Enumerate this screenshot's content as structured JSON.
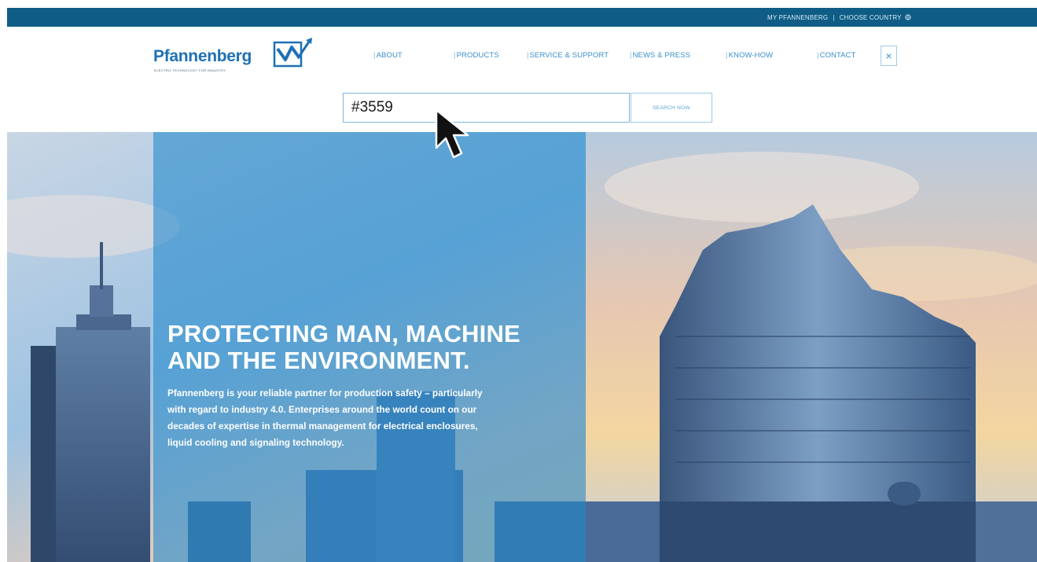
{
  "topbar": {
    "my_account": "MY PFANNENBERG",
    "separator": "|",
    "country": "CHOOSE COUNTRY",
    "country_icon": "globe-icon"
  },
  "logo": {
    "wordmark": "Pfannenberg",
    "tagline": "ELECTRO-TECHNOLOGY FOR INDUSTRY"
  },
  "nav": {
    "items": [
      {
        "label": "ABOUT"
      },
      {
        "label": "PRODUCTS"
      },
      {
        "label": "SERVICE & SUPPORT"
      },
      {
        "label": "NEWS & PRESS"
      },
      {
        "label": "KNOW-HOW"
      },
      {
        "label": "CONTACT"
      }
    ],
    "close_icon": "close-icon",
    "close_glyph": "×"
  },
  "search": {
    "value": "#3559",
    "button_label": "SEARCH NOW"
  },
  "hero": {
    "title_line1": "PROTECTING MAN, MACHINE",
    "title_line2": "AND THE ENVIRONMENT.",
    "text_line1": "Pfannenberg is your reliable partner for production safety – particularly",
    "text_line2": "with regard to industry 4.0. Enterprises around the world count on our",
    "text_line3": "decades of expertise in thermal management for electrical enclosures,",
    "text_line4": "liquid cooling and signaling technology."
  },
  "colors": {
    "brand_blue": "#1e70b5",
    "topbar": "#0f5d86",
    "nav_text": "#3a8fcb",
    "hero_overlay": "#2a8ccd"
  }
}
